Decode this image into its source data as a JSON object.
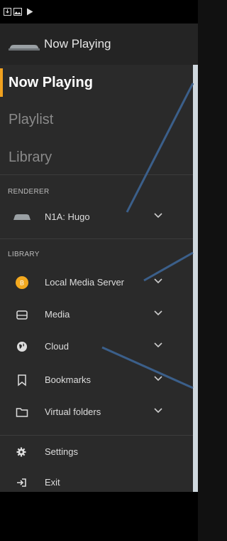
{
  "status_bar": {
    "icons": [
      "download-icon",
      "image-icon",
      "play-icon"
    ]
  },
  "app_bar": {
    "title": "Now Playing"
  },
  "drawer": {
    "main_items": [
      {
        "label": "Now Playing",
        "active": true
      },
      {
        "label": "Playlist",
        "active": false
      },
      {
        "label": "Library",
        "active": false
      }
    ],
    "renderer_header": "RENDERER",
    "renderer": {
      "label": "N1A: Hugo"
    },
    "library_header": "LIBRARY",
    "library_items": [
      {
        "label": "Local Media Server",
        "icon": "media-server-icon"
      },
      {
        "label": "Media",
        "icon": "drive-icon"
      },
      {
        "label": "Cloud",
        "icon": "cloud-globe-icon"
      },
      {
        "label": "Bookmarks",
        "icon": "bookmark-icon"
      },
      {
        "label": "Virtual folders",
        "icon": "folder-icon"
      }
    ],
    "settings": {
      "label": "Settings"
    },
    "exit": {
      "label": "Exit"
    }
  },
  "colors": {
    "accent": "#f0a11f",
    "drawer_bg": "#2a2a2a",
    "app_bar_bg": "#242424",
    "annotation_line": "#3b5f8a",
    "server_icon": "#f3a91f"
  }
}
